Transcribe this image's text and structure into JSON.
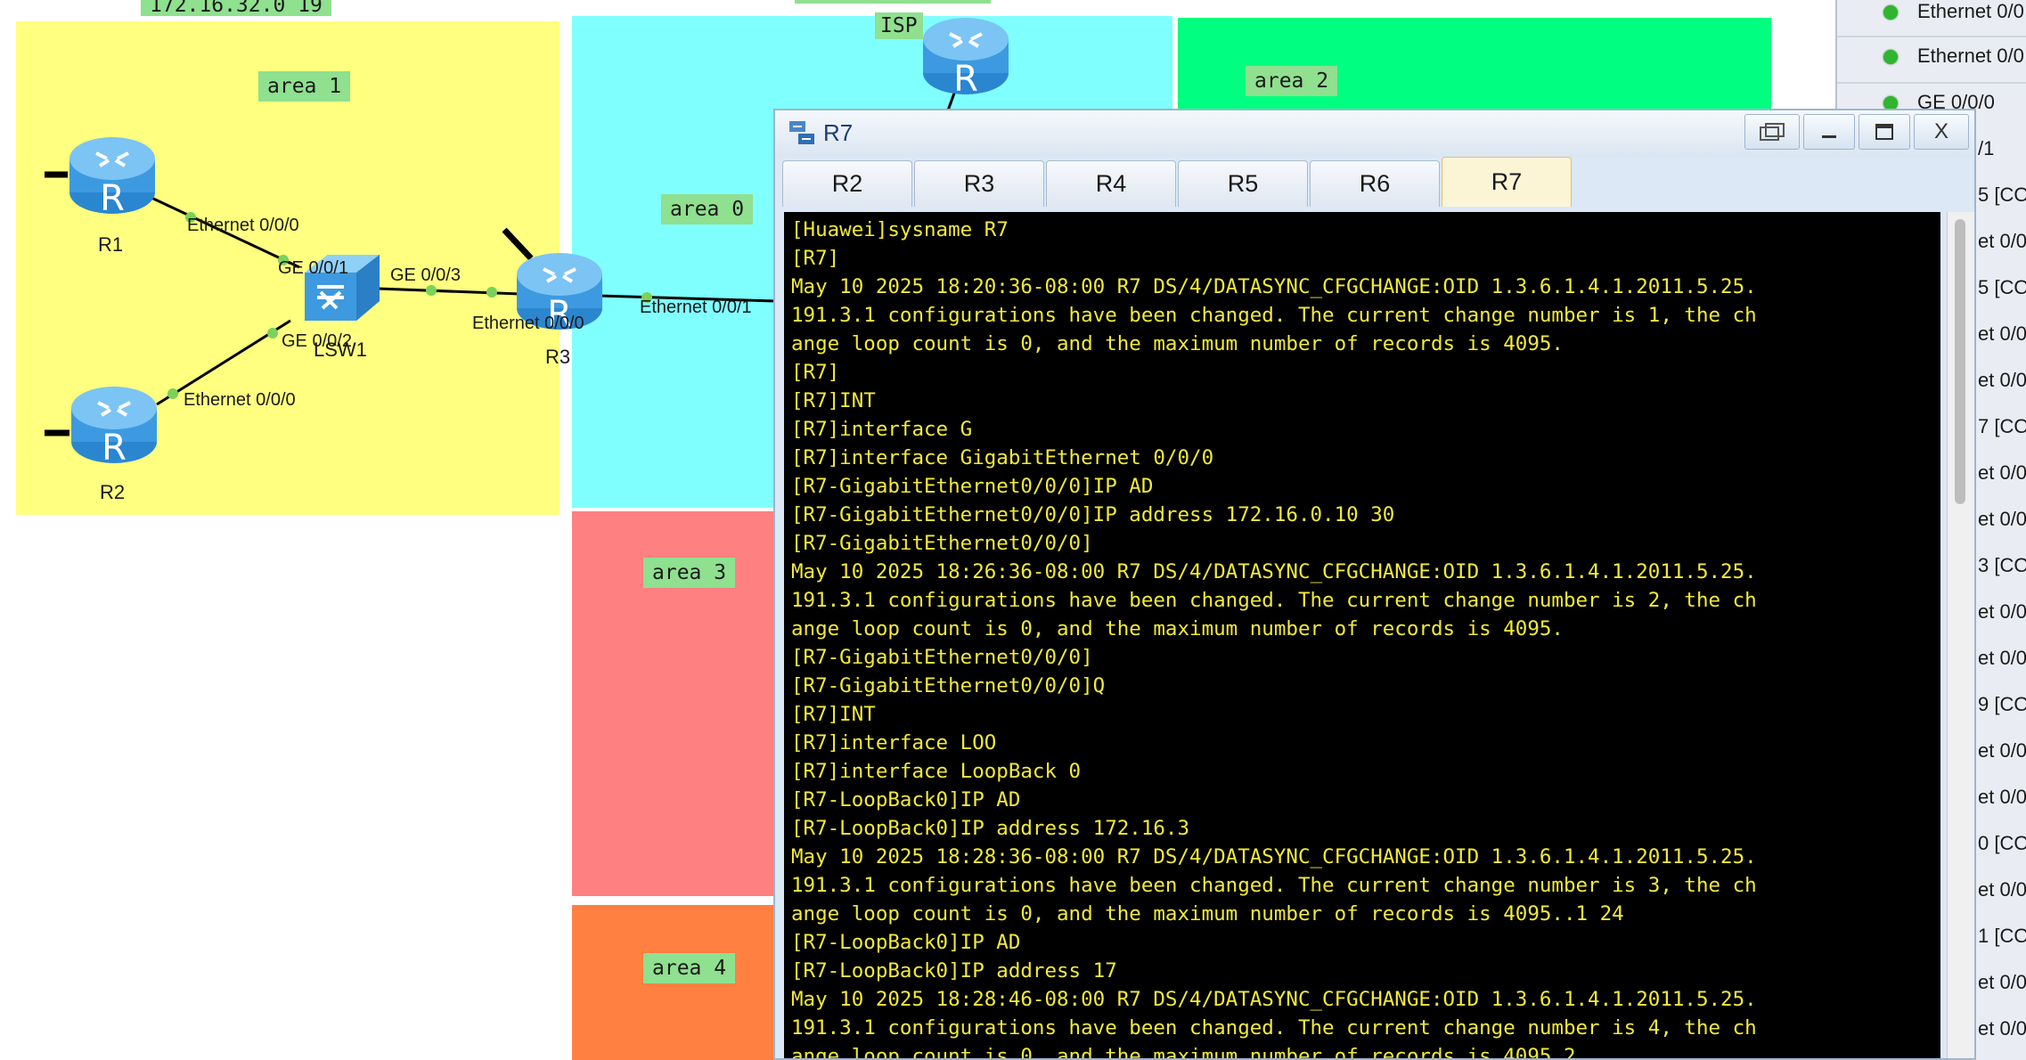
{
  "topology": {
    "subnet_label": "172.16.32.0 19",
    "isp_label": "ISP",
    "areas": {
      "area1": "area 1",
      "area0": "area 0",
      "area2": "area 2",
      "area3": "area 3",
      "area4": "area 4"
    },
    "area_colors": {
      "area1": "#ffff80",
      "area0": "#80ffff",
      "area2": "#00ff80",
      "area3": "#ff8080",
      "area4": "#ff8040"
    },
    "devices": {
      "r1": "R1",
      "r2": "R2",
      "r3": "R3",
      "lsw1": "LSW1",
      "router_glyph": "R"
    },
    "ports": {
      "r1_eth": "Ethernet 0/0/0",
      "lsw_ge1": "GE 0/0/1",
      "lsw_ge3": "GE 0/0/3",
      "lsw_ge2": "GE 0/0/2",
      "r2_eth": "Ethernet 0/0/0",
      "r3_eth0": "Ethernet 0/0/0",
      "r3_eth1": "Ethernet 0/0/1"
    },
    "icons": [
      "router-icon",
      "switch-icon"
    ]
  },
  "window": {
    "title": "R7",
    "icon": "terminal-app-icon",
    "controls": [
      "restore-icon",
      "minimize-icon",
      "maximize-icon",
      "close-icon"
    ],
    "close_label": "X",
    "tabs": [
      "R2",
      "R3",
      "R4",
      "R5",
      "R6",
      "R7"
    ],
    "active_tab": "R7"
  },
  "terminal": {
    "text_color": "#f2ea3a",
    "lines": [
      "[Huawei]sysname R7",
      "[R7]",
      "May 10 2025 18:20:36-08:00 R7 DS/4/DATASYNC_CFGCHANGE:OID 1.3.6.1.4.1.2011.5.25.",
      "191.3.1 configurations have been changed. The current change number is 1, the ch",
      "ange loop count is 0, and the maximum number of records is 4095.",
      "[R7]",
      "[R7]INT",
      "[R7]interface G",
      "[R7]interface GigabitEthernet 0/0/0",
      "[R7-GigabitEthernet0/0/0]IP AD",
      "[R7-GigabitEthernet0/0/0]IP address 172.16.0.10 30",
      "[R7-GigabitEthernet0/0/0]",
      "May 10 2025 18:26:36-08:00 R7 DS/4/DATASYNC_CFGCHANGE:OID 1.3.6.1.4.1.2011.5.25.",
      "191.3.1 configurations have been changed. The current change number is 2, the ch",
      "ange loop count is 0, and the maximum number of records is 4095.",
      "[R7-GigabitEthernet0/0/0]",
      "[R7-GigabitEthernet0/0/0]Q",
      "[R7]INT",
      "[R7]interface LOO",
      "[R7]interface LoopBack 0",
      "[R7-LoopBack0]IP AD",
      "[R7-LoopBack0]IP address 172.16.3",
      "May 10 2025 18:28:36-08:00 R7 DS/4/DATASYNC_CFGCHANGE:OID 1.3.6.1.4.1.2011.5.25.",
      "191.3.1 configurations have been changed. The current change number is 3, the ch",
      "ange loop count is 0, and the maximum number of records is 4095..1 24",
      "[R7-LoopBack0]IP AD",
      "[R7-LoopBack0]IP address 17",
      "May 10 2025 18:28:46-08:00 R7 DS/4/DATASYNC_CFGCHANGE:OID 1.3.6.1.4.1.2011.5.25.",
      "191.3.1 configurations have been changed. The current change number is 4, the ch",
      "ange loop count is 0, and the maximum number of records is 4095.2"
    ]
  },
  "right_panel": {
    "interfaces": [
      "Ethernet 0/0",
      "Ethernet 0/0",
      "GE 0/0/0"
    ],
    "status_color": "#2fb52f",
    "cut_items": [
      "/1",
      "5 [CO",
      "et 0/0",
      "5 [CO",
      "et 0/0",
      "et 0/0",
      "7 [CO",
      "et 0/0",
      "et 0/0",
      "3 [CO",
      "et 0/0",
      "et 0/0",
      "9 [CO",
      "et 0/0",
      "et 0/0",
      "0 [CO",
      "et 0/0",
      "1 [CO",
      "et 0/0",
      "et 0/0"
    ]
  }
}
